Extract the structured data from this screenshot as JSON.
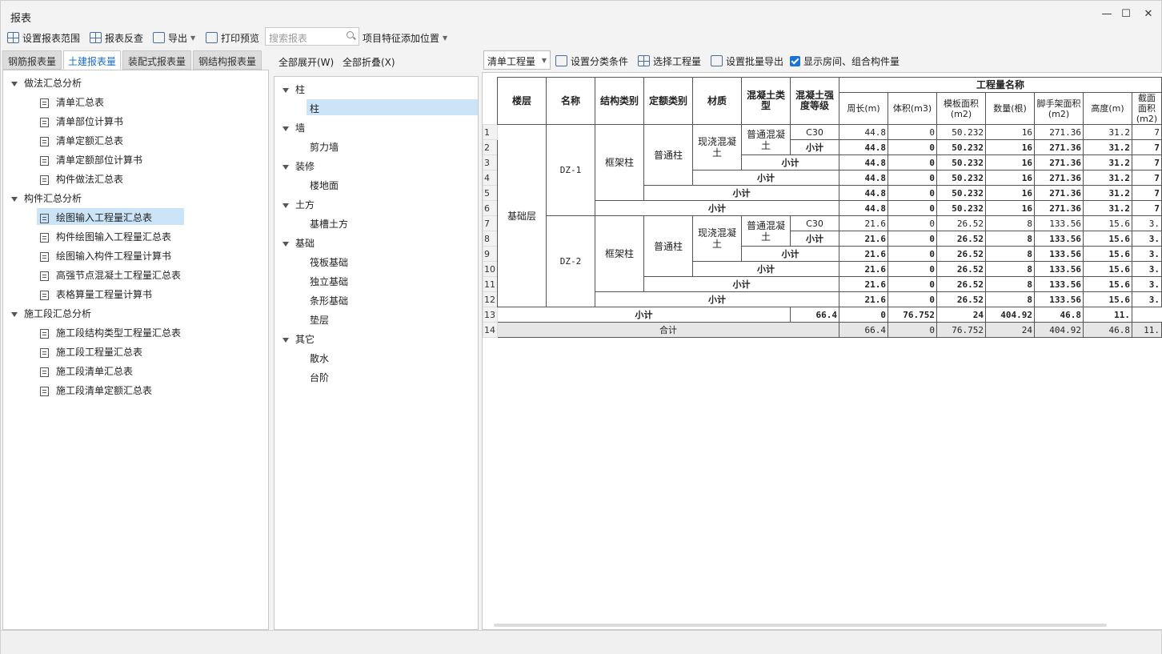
{
  "window": {
    "title": "报表",
    "min": "—",
    "max": "☐",
    "close": "✕"
  },
  "toolbar": {
    "set_range": "设置报表范围",
    "reverse": "报表反查",
    "export": "导出",
    "print_preview": "打印预览",
    "search_placeholder": "搜索报表",
    "feature_pos": "项目特征添加位置"
  },
  "tabs": [
    "钢筋报表量",
    "土建报表量",
    "装配式报表量",
    "钢结构报表量"
  ],
  "tree": {
    "groups": [
      {
        "label": "做法汇总分析",
        "items": [
          "清单汇总表",
          "清单部位计算书",
          "清单定额汇总表",
          "清单定额部位计算书",
          "构件做法汇总表"
        ]
      },
      {
        "label": "构件汇总分析",
        "items": [
          "绘图输入工程量汇总表",
          "构件绘图输入工程量汇总表",
          "绘图输入构件工程量计算书",
          "高强节点混凝土工程量汇总表",
          "表格算量工程量计算书"
        ]
      },
      {
        "label": "施工段汇总分析",
        "items": [
          "施工段结构类型工程量汇总表",
          "施工段工程量汇总表",
          "施工段清单汇总表",
          "施工段清单定额汇总表"
        ]
      }
    ]
  },
  "middle": {
    "expand_all": "全部展开(W)",
    "collapse_all": "全部折叠(X)",
    "groups": [
      {
        "label": "柱",
        "items": [
          "柱"
        ]
      },
      {
        "label": "墙",
        "items": [
          "剪力墙"
        ]
      },
      {
        "label": "装修",
        "items": [
          "楼地面"
        ]
      },
      {
        "label": "土方",
        "items": [
          "基槽土方"
        ]
      },
      {
        "label": "基础",
        "items": [
          "筏板基础",
          "独立基础",
          "条形基础",
          "垫层"
        ]
      },
      {
        "label": "其它",
        "items": [
          "散水",
          "台阶"
        ]
      }
    ]
  },
  "right_toolbar": {
    "combo": "清单工程量",
    "set_classify": "设置分类条件",
    "select_qty": "选择工程量",
    "batch_export": "设置批量导出",
    "show_rooms": "显示房间、组合构件量"
  },
  "table": {
    "headers": {
      "floor": "楼层",
      "name": "名称",
      "struct_type": "结构类别",
      "quota_type": "定额类别",
      "material": "材质",
      "concrete_type": "混凝土类型",
      "concrete_grade": "混凝土强度等级",
      "qty_group": "工程量名称",
      "cols": [
        "周长(m)",
        "体积(m3)",
        "模板面积(m2)",
        "数量(根)",
        "脚手架面积(m2)",
        "高度(m)",
        "截面面积(m2)"
      ]
    },
    "cells": {
      "floor": "基础层",
      "dz1": "DZ-1",
      "dz2": "DZ-2",
      "frame_col": "框架柱",
      "normal_col": "普通柱",
      "cast_concrete": "现浇混凝土",
      "normal_concrete": "普通混凝土",
      "c30": "C30",
      "subtotal": "小计",
      "total": "合计"
    },
    "row_numbers": [
      "1",
      "2",
      "3",
      "4",
      "5",
      "6",
      "7",
      "8",
      "9",
      "10",
      "11",
      "12",
      "13",
      "14"
    ],
    "values": [
      [
        "44.8",
        "0",
        "50.232",
        "16",
        "271.36",
        "31.2",
        "7"
      ],
      [
        "44.8",
        "0",
        "50.232",
        "16",
        "271.36",
        "31.2",
        "7"
      ],
      [
        "44.8",
        "0",
        "50.232",
        "16",
        "271.36",
        "31.2",
        "7"
      ],
      [
        "44.8",
        "0",
        "50.232",
        "16",
        "271.36",
        "31.2",
        "7"
      ],
      [
        "44.8",
        "0",
        "50.232",
        "16",
        "271.36",
        "31.2",
        "7"
      ],
      [
        "44.8",
        "0",
        "50.232",
        "16",
        "271.36",
        "31.2",
        "7"
      ],
      [
        "21.6",
        "0",
        "26.52",
        "8",
        "133.56",
        "15.6",
        "3."
      ],
      [
        "21.6",
        "0",
        "26.52",
        "8",
        "133.56",
        "15.6",
        "3."
      ],
      [
        "21.6",
        "0",
        "26.52",
        "8",
        "133.56",
        "15.6",
        "3."
      ],
      [
        "21.6",
        "0",
        "26.52",
        "8",
        "133.56",
        "15.6",
        "3."
      ],
      [
        "21.6",
        "0",
        "26.52",
        "8",
        "133.56",
        "15.6",
        "3."
      ],
      [
        "21.6",
        "0",
        "26.52",
        "8",
        "133.56",
        "15.6",
        "3."
      ],
      [
        "66.4",
        "0",
        "76.752",
        "24",
        "404.92",
        "46.8",
        "11."
      ],
      [
        "66.4",
        "0",
        "76.752",
        "24",
        "404.92",
        "46.8",
        "11."
      ]
    ]
  }
}
